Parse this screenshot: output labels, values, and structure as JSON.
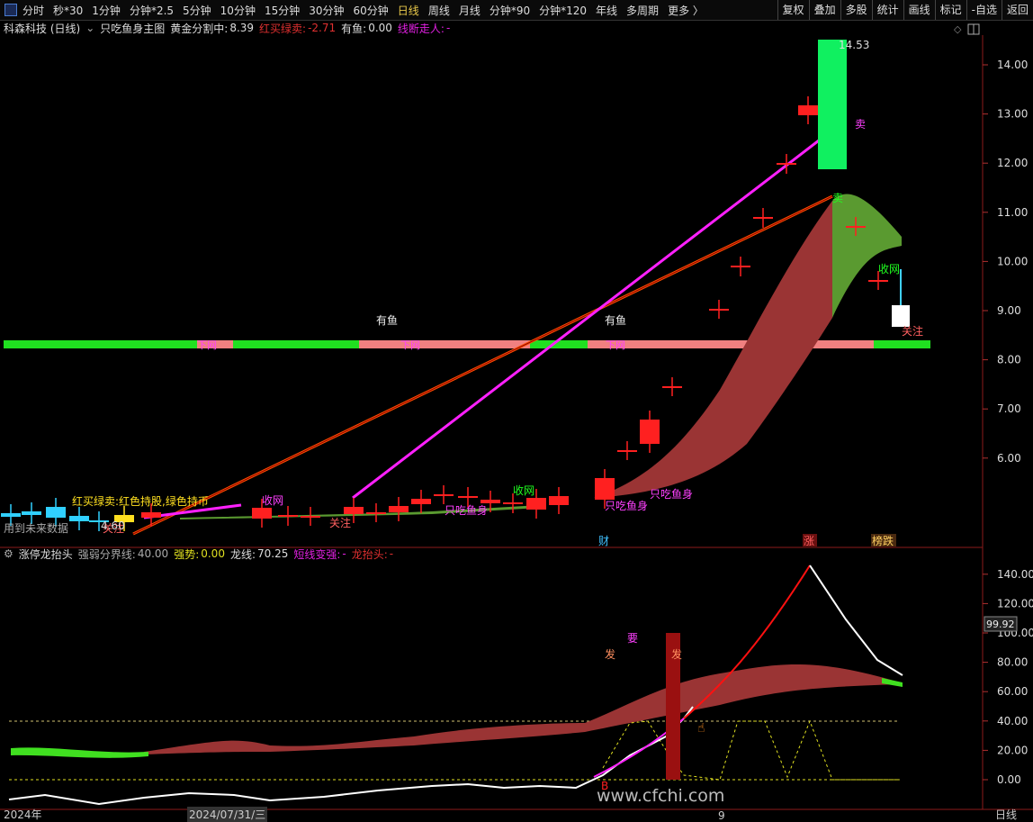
{
  "toolbar": {
    "periods": [
      "分时",
      "秒*30",
      "1分钟",
      "分钟*2.5",
      "5分钟",
      "10分钟",
      "15分钟",
      "30分钟",
      "60分钟",
      "日线",
      "周线",
      "月线",
      "分钟*90",
      "分钟*120",
      "年线",
      "多周期",
      "更多 〉"
    ],
    "active_period": "日线",
    "tools": [
      "复权",
      "叠加",
      "多股",
      "统计",
      "画线",
      "标记",
      "-自选",
      "返回"
    ]
  },
  "main_info": {
    "stock": "科森科技 (日线)",
    "indicator": "只吃鱼身主图",
    "gold_label": "黄金分割中:",
    "gold_value": "8.39",
    "redgreen_label": "红买绿卖:",
    "redgreen_value": "-2.71",
    "fish_label": "有鱼:",
    "fish_value": "0.00",
    "follow_label": "线断走人:",
    "follow_value": "-"
  },
  "sub_info": {
    "name": "涨停龙抬头",
    "strongweak_label": "强弱分界线:",
    "strongweak_value": "40.00",
    "strong_label": "强势:",
    "strong_value": "0.00",
    "dragon_label": "龙线:",
    "dragon_value": "70.25",
    "short_label": "短线变强:",
    "short_value": "-",
    "head_label": "龙抬头:",
    "head_value": "-"
  },
  "main_axis": [
    "14.00",
    "13.00",
    "12.00",
    "11.00",
    "10.00",
    "9.00",
    "8.00",
    "7.00",
    "6.00"
  ],
  "sub_axis": [
    "140.00",
    "120.00",
    "100.00",
    "80.00",
    "60.00",
    "40.00",
    "20.00",
    "0.00"
  ],
  "sub_current": "99.92",
  "annotations": {
    "high_price": "14.53",
    "low_price": "4.60",
    "fish1": "有鱼",
    "fish2": "有鱼",
    "sell": "卖",
    "close_net": "收网",
    "watch": "关注",
    "down_net": "下网",
    "fish_body": "只吃鱼身",
    "legend": "红买绿卖:红色持股,绿色持币",
    "future_data": "用到未来数据",
    "cai": "财",
    "zhang": "涨",
    "bang_die": "榜跌",
    "fa": "发",
    "yao": "要",
    "b_marker": "B"
  },
  "watermark": "www.cfchi.com",
  "bottom_axis": {
    "year": "2024年",
    "date": "2024/07/31/三",
    "day": "9",
    "period": "日线"
  }
}
